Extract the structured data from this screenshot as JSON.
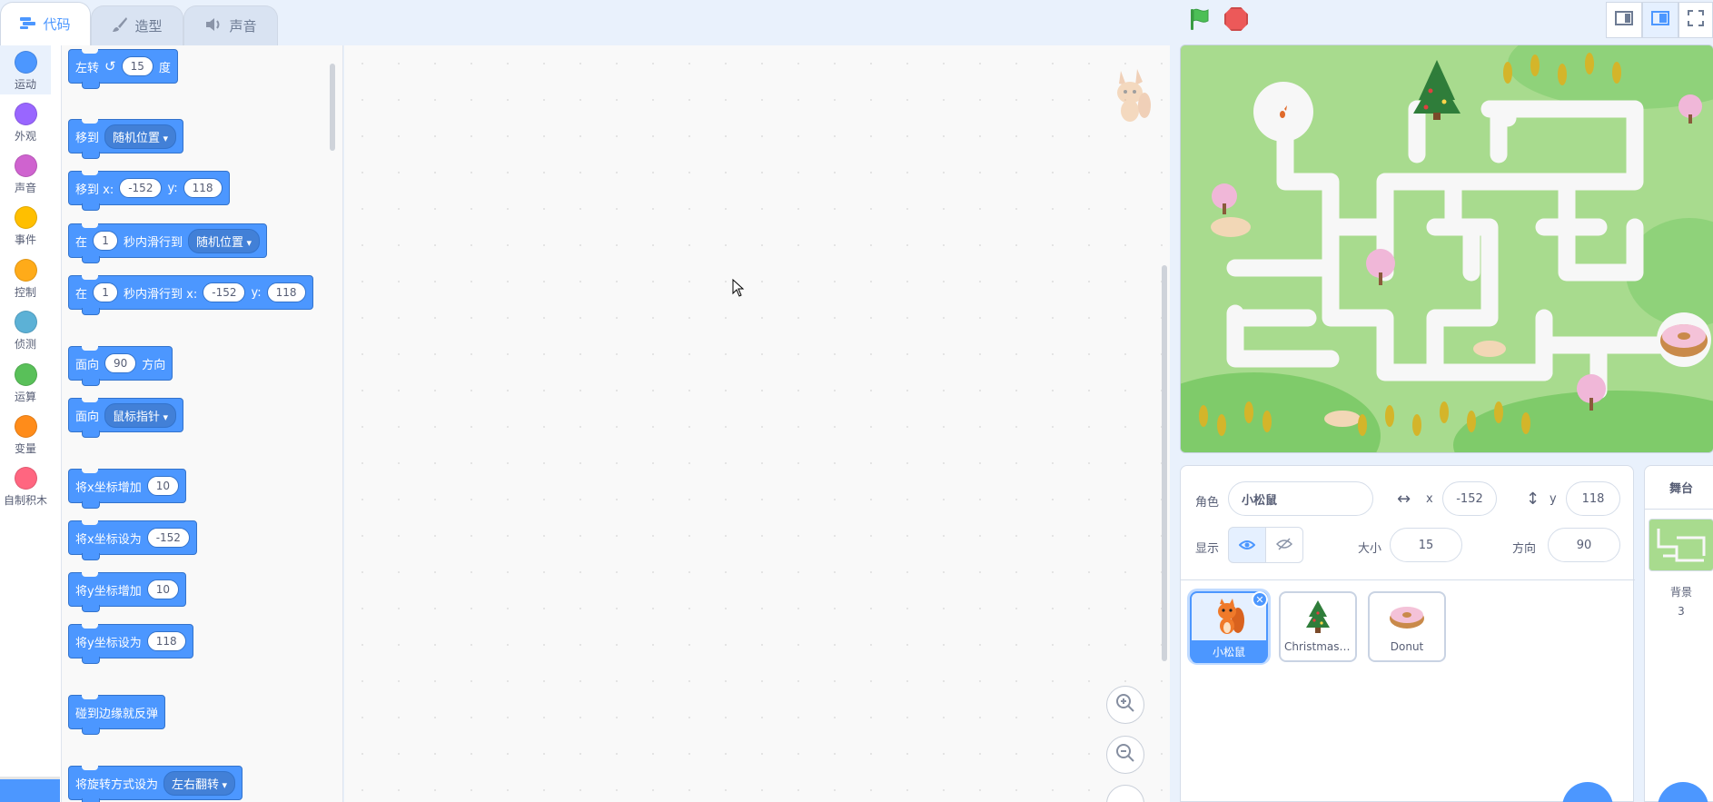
{
  "tabs": [
    {
      "label": "代码",
      "icon": "code-icon"
    },
    {
      "label": "造型",
      "icon": "brush-icon"
    },
    {
      "label": "声音",
      "icon": "speaker-icon"
    }
  ],
  "categories": [
    {
      "label": "运动",
      "color": "#4c97ff"
    },
    {
      "label": "外观",
      "color": "#9966ff"
    },
    {
      "label": "声音",
      "color": "#cf63cf"
    },
    {
      "label": "事件",
      "color": "#ffbf00"
    },
    {
      "label": "控制",
      "color": "#ffab19"
    },
    {
      "label": "侦测",
      "color": "#5cb1d6"
    },
    {
      "label": "运算",
      "color": "#59c059"
    },
    {
      "label": "变量",
      "color": "#ff8c1a"
    },
    {
      "label": "自制积木",
      "color": "#ff6680"
    }
  ],
  "blocks": {
    "turn_left": {
      "text": "左转",
      "value": "15",
      "unit": "度"
    },
    "goto": {
      "text": "移到",
      "option": "随机位置"
    },
    "goto_xy": {
      "text": "移到 x:",
      "x": "-152",
      "y_label": "y:",
      "y": "118"
    },
    "glide": {
      "pre": "在",
      "secs": "1",
      "mid": "秒内滑行到",
      "option": "随机位置"
    },
    "glide_xy": {
      "pre": "在",
      "secs": "1",
      "mid": "秒内滑行到 x:",
      "x": "-152",
      "y_label": "y:",
      "y": "118"
    },
    "point_dir": {
      "text": "面向",
      "value": "90",
      "unit": "方向"
    },
    "point_towards": {
      "text": "面向",
      "option": "鼠标指针"
    },
    "change_x": {
      "text": "将x坐标增加",
      "value": "10"
    },
    "set_x": {
      "text": "将x坐标设为",
      "value": "-152"
    },
    "change_y": {
      "text": "将y坐标增加",
      "value": "10"
    },
    "set_y": {
      "text": "将y坐标设为",
      "value": "118"
    },
    "bounce": {
      "text": "碰到边缘就反弹"
    },
    "rot_style": {
      "text": "将旋转方式设为",
      "option": "左右翻转"
    }
  },
  "sprite_info": {
    "sprite_label": "角色",
    "sprite_name": "小松鼠",
    "x_label": "x",
    "x": "-152",
    "y_label": "y",
    "y": "118",
    "show_label": "显示",
    "size_label": "大小",
    "size": "15",
    "direction_label": "方向",
    "direction": "90"
  },
  "sprites": [
    {
      "name": "小松鼠",
      "selected": true
    },
    {
      "name": "Christmas ...",
      "selected": false
    },
    {
      "name": "Donut",
      "selected": false
    }
  ],
  "stage_pane": {
    "title": "舞台",
    "backdrop_label": "背景",
    "backdrop_count": "3"
  },
  "colors": {
    "accent": "#4c97ff",
    "motion": "#4c97ff",
    "stop": "#ec5959",
    "flag": "#4cbf56"
  }
}
